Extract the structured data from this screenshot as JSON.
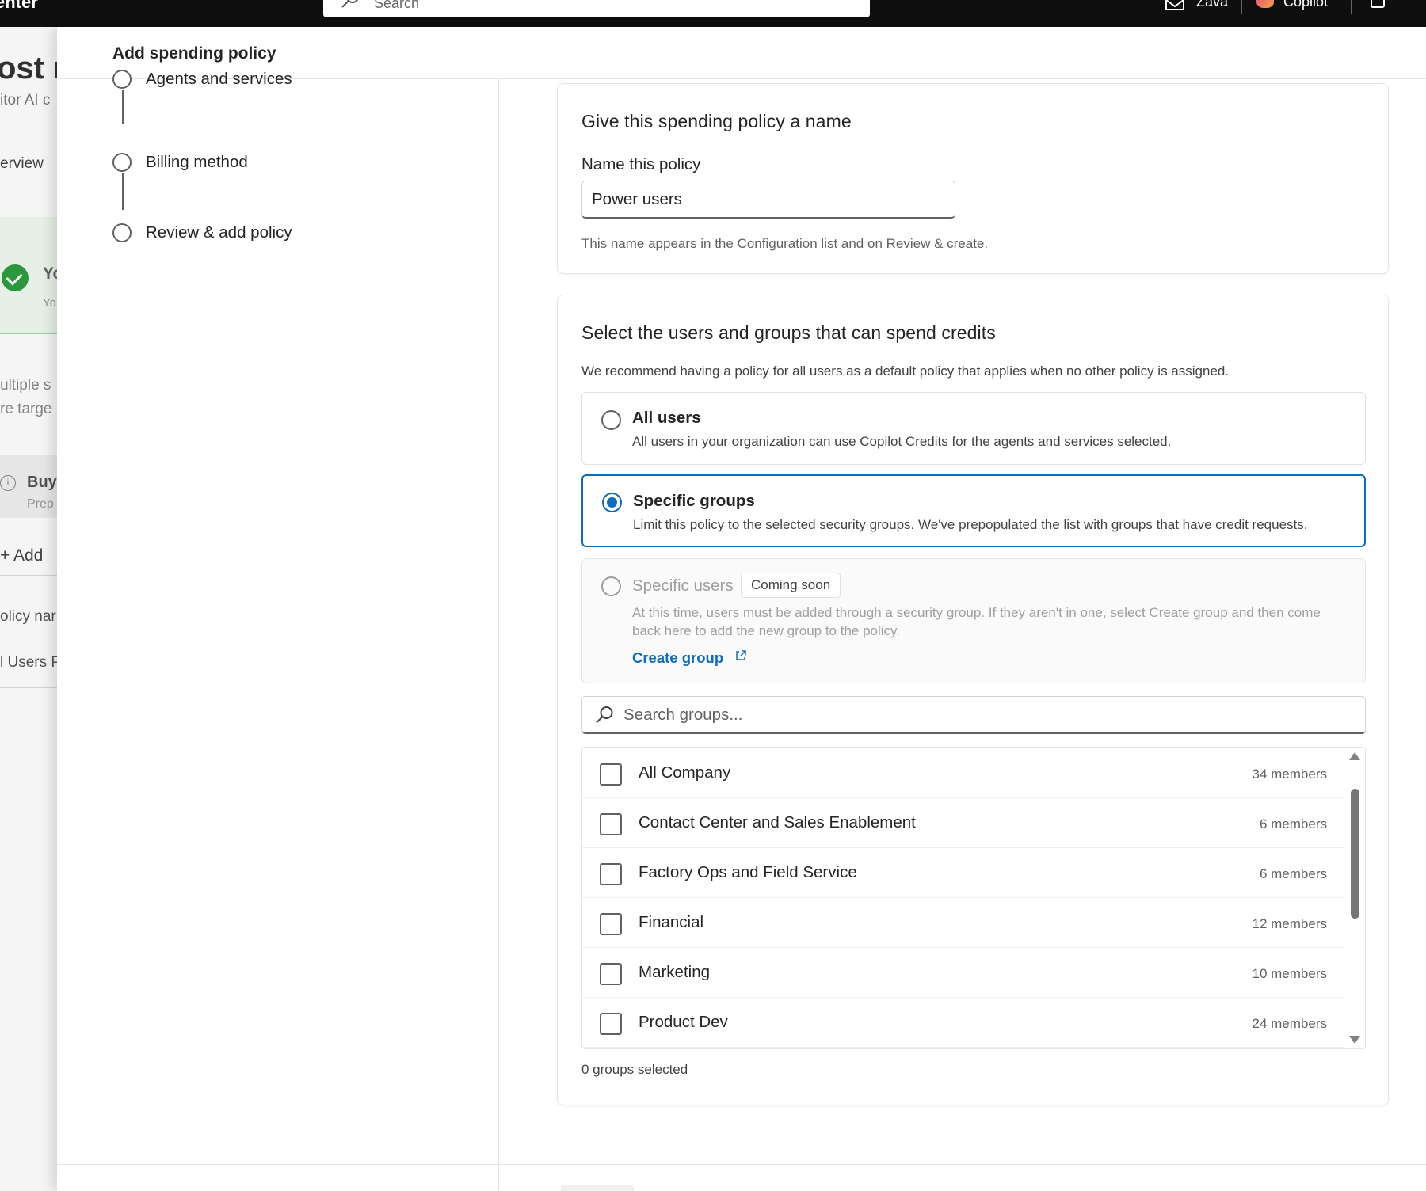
{
  "topbar": {
    "brand": "enter",
    "search_placeholder": "Search",
    "org": "Zava",
    "copilot": "Copilot"
  },
  "background_page": {
    "title": "ost m",
    "subtitle": "itor AI c",
    "overview": "erview",
    "success_title": "Yo",
    "success_sub": "Yo",
    "multi_line1": "ultiple s",
    "multi_line2": "re targe",
    "buy_title": "Buy",
    "buy_sub": "Prep",
    "add_label": "Add",
    "policy_name_col": "olicy nar",
    "users_row": "l Users P"
  },
  "dialog": {
    "title": "Add spending policy",
    "steps": [
      {
        "label": "Agents and services"
      },
      {
        "label": "Billing method"
      },
      {
        "label": "Review & add policy"
      }
    ],
    "name_card": {
      "heading": "Give this spending policy a name",
      "field_label": "Name this policy",
      "field_value": "Power users",
      "hint": "This name appears in the Configuration list and on Review & create."
    },
    "users_card": {
      "heading": "Select the users and groups that can spend credits",
      "description": "We recommend having a policy for all users as a default policy that applies when no other policy is assigned.",
      "options": {
        "all_users": {
          "title": "All users",
          "desc": "All users in your organization can use Copilot Credits for the agents and services selected."
        },
        "specific_groups": {
          "title": "Specific groups",
          "desc": "Limit this policy to the selected security groups. We've prepopulated the list with groups that have credit requests."
        },
        "specific_users": {
          "title": "Specific users",
          "badge": "Coming soon",
          "desc": "At this time, users must be added through a security group. If they aren't in one, select Create group and then come back here to add the new group to the policy.",
          "link": "Create group"
        }
      },
      "selected_option": "specific_groups",
      "search_placeholder": "Search groups...",
      "groups": [
        {
          "name": "All Company",
          "members": "34 members"
        },
        {
          "name": "Contact Center and Sales Enablement",
          "members": "6 members"
        },
        {
          "name": "Factory Ops and Field Service",
          "members": "6 members"
        },
        {
          "name": "Financial",
          "members": "12 members"
        },
        {
          "name": "Marketing",
          "members": "10 members"
        },
        {
          "name": "Product Dev",
          "members": "24 members"
        }
      ],
      "selected_count": "0 groups selected"
    }
  },
  "colors": {
    "accent": "#0f6cbd",
    "topbar_bg": "#0f0f0f",
    "success": "#2e9e3e"
  }
}
